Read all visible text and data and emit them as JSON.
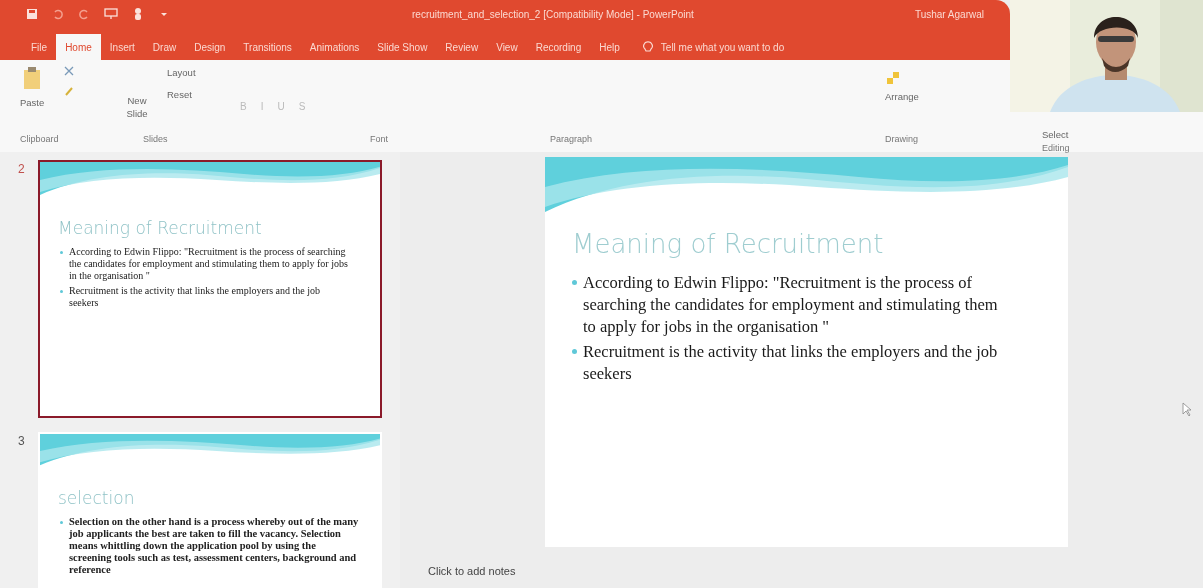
{
  "window": {
    "title": "recruitment_and_selection_2 [Compatibility Mode] - PowerPoint",
    "user": "Tushar Agarwal"
  },
  "tabs": [
    {
      "label": "File",
      "selected": false
    },
    {
      "label": "Home",
      "selected": true
    },
    {
      "label": "Insert",
      "selected": false
    },
    {
      "label": "Draw",
      "selected": false
    },
    {
      "label": "Design",
      "selected": false
    },
    {
      "label": "Transitions",
      "selected": false
    },
    {
      "label": "Animations",
      "selected": false
    },
    {
      "label": "Slide Show",
      "selected": false
    },
    {
      "label": "Review",
      "selected": false
    },
    {
      "label": "View",
      "selected": false
    },
    {
      "label": "Recording",
      "selected": false
    },
    {
      "label": "Help",
      "selected": false
    }
  ],
  "tell_me": {
    "placeholder": "Tell me what you want to do"
  },
  "ribbon": {
    "clipboard": {
      "label": "Clipboard",
      "paste": "Paste"
    },
    "slides": {
      "label": "Slides",
      "new_slide": "New Slide",
      "layout": "Layout",
      "reset": "Reset"
    },
    "font": {
      "label": "Font",
      "format_buttons": [
        "B",
        "I",
        "U",
        "S"
      ]
    },
    "paragraph": {
      "label": "Paragraph"
    },
    "drawing": {
      "label": "Drawing",
      "arrange": "Arrange"
    },
    "editing": {
      "label": "Editing",
      "select": "Select"
    }
  },
  "thumbnails": [
    {
      "number": "2",
      "selected": true,
      "title": "Meaning of Recruitment",
      "bullets": [
        "According to Edwin Flippo: \"Recruitment is the process of searching the candidates for employment and stimulating them to apply for jobs in the organisation \"",
        "Recruitment is the activity that links the employers and the job seekers"
      ]
    },
    {
      "number": "3",
      "selected": false,
      "title": "selection",
      "bullets": [
        "Selection on the other hand is  a process whereby out of the many job applicants the best are taken to fill the vacancy. Selection means whittling down the application pool by using the screening tools such as test, assessment centers, background and reference"
      ]
    }
  ],
  "slide": {
    "title": "Meaning of Recruitment",
    "bullets": [
      "According to Edwin Flippo: \"Recruitment is the process of searching the candidates for employment and stimulating them to apply for jobs in the organisation \"",
      "Recruitment is the activity that links the employers and the job seekers"
    ]
  },
  "notes": {
    "placeholder": "Click to add notes"
  }
}
